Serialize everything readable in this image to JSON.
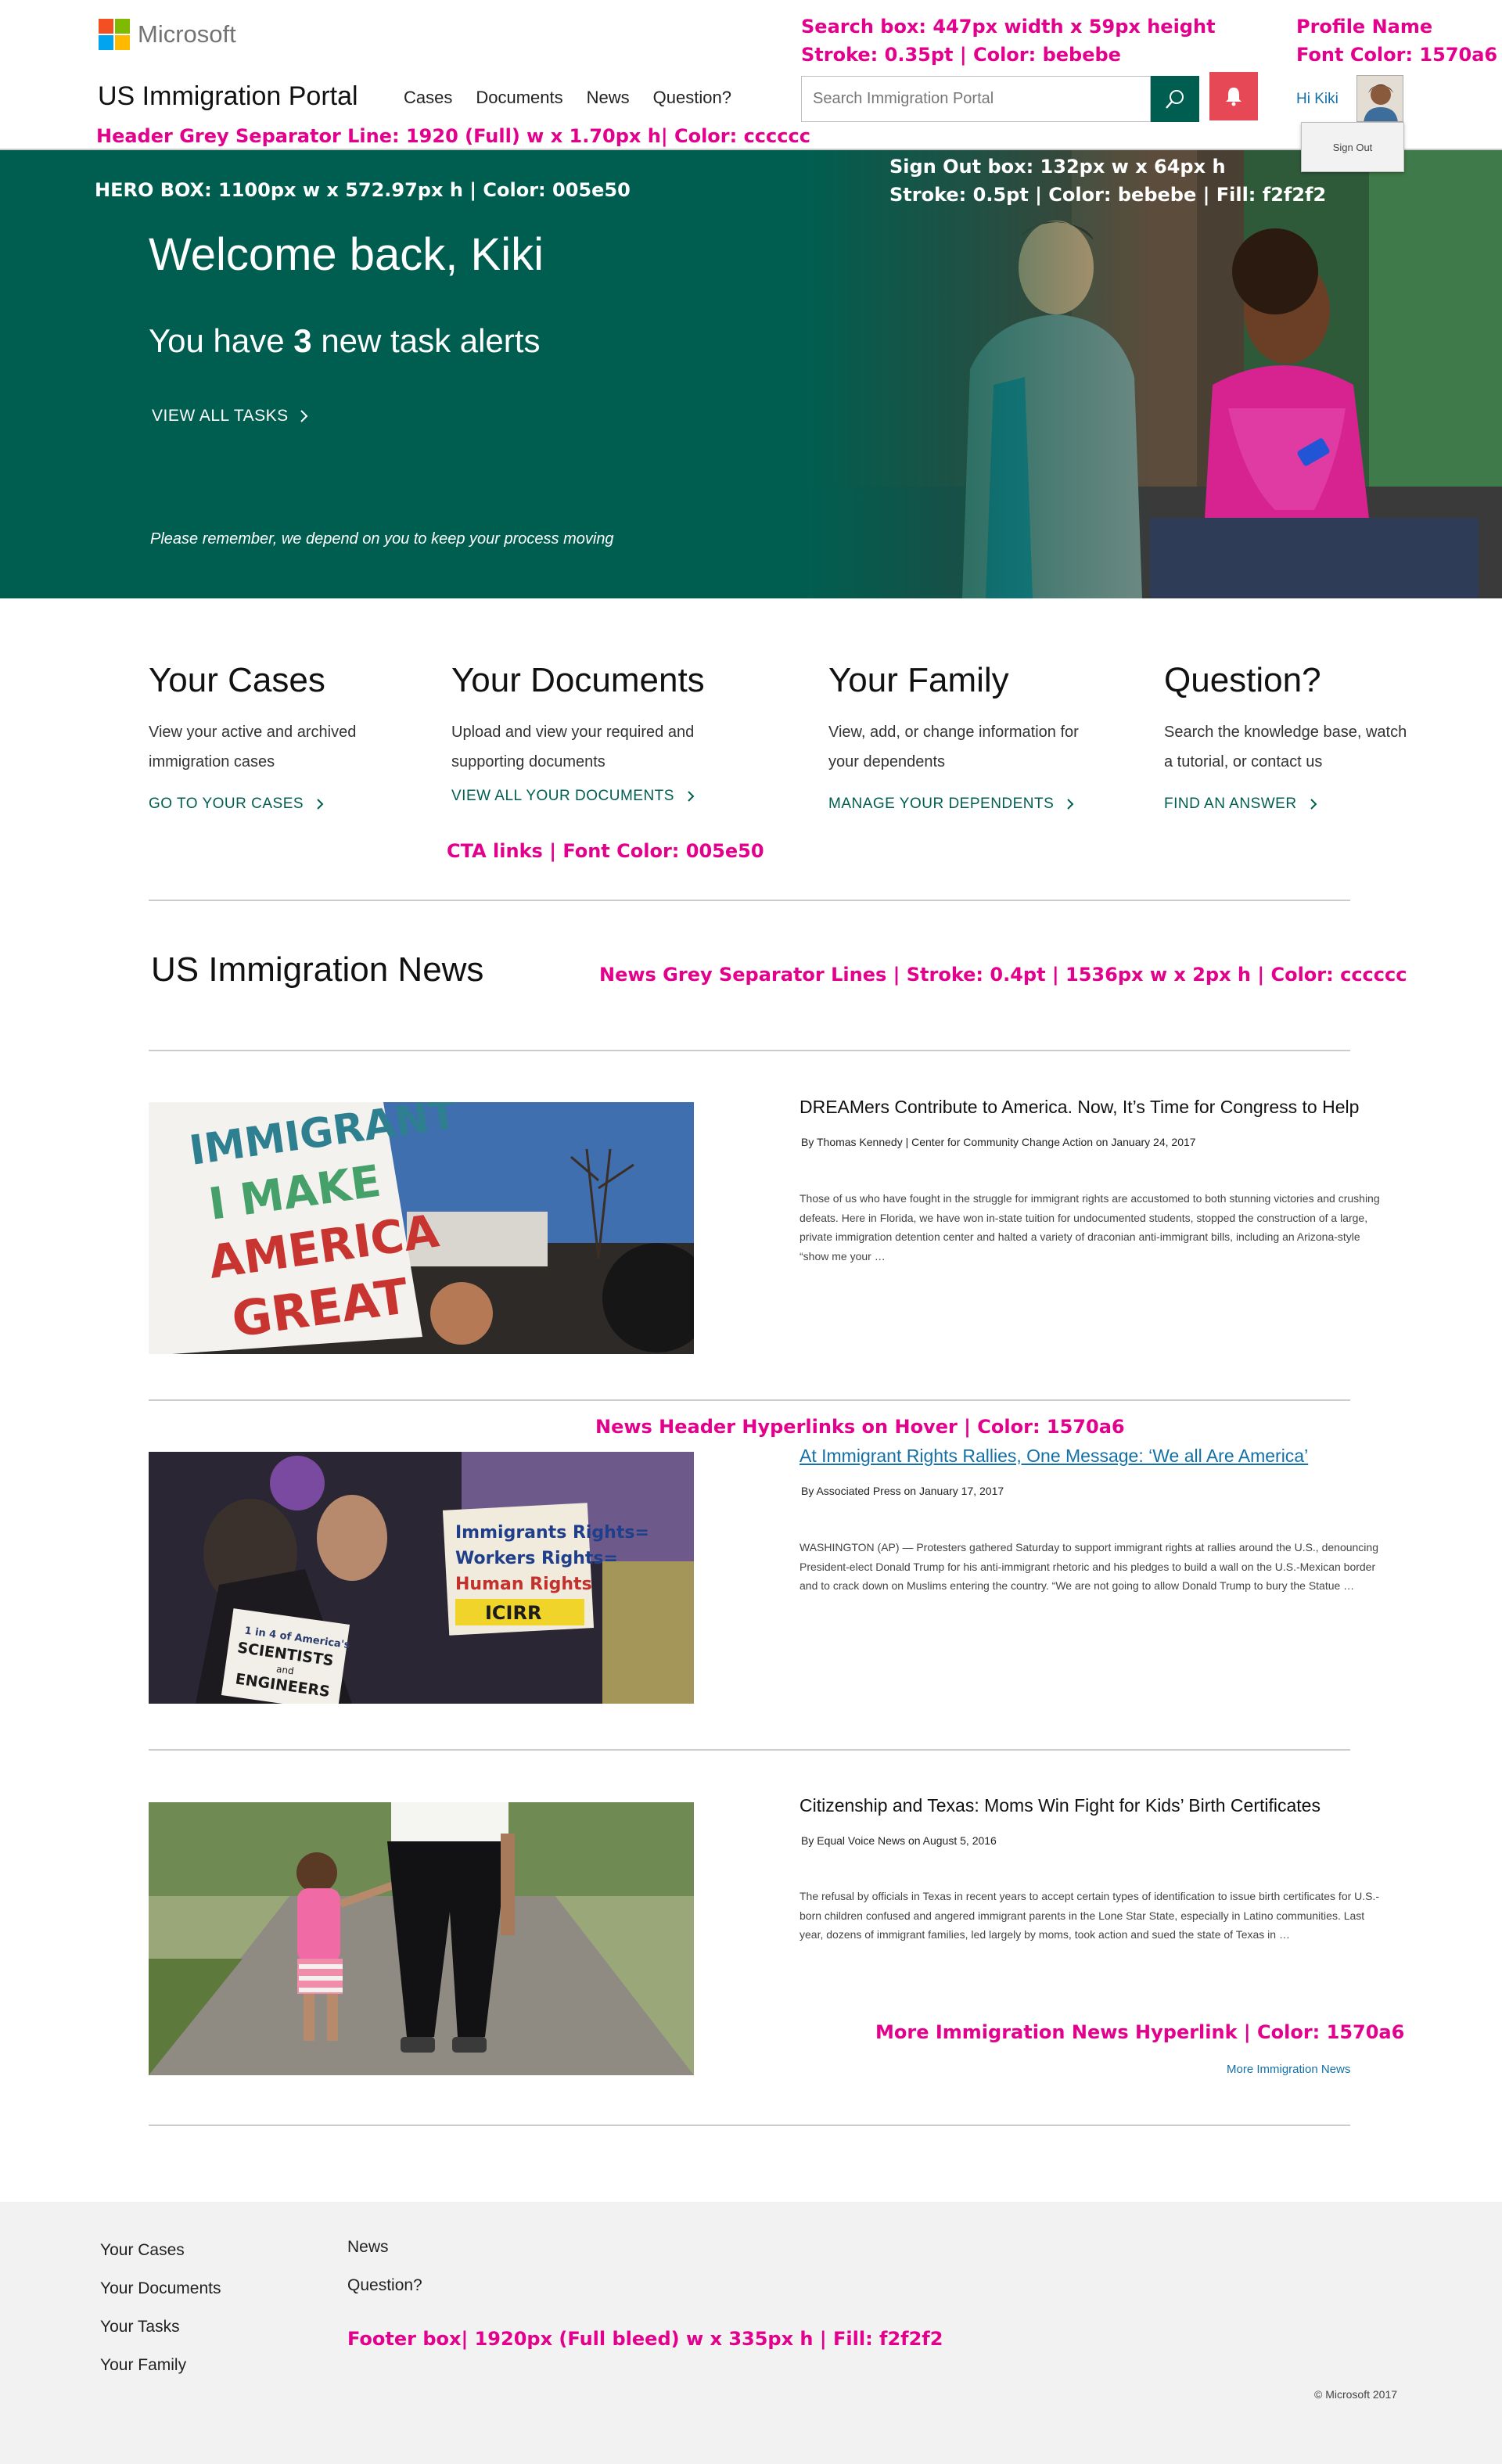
{
  "header": {
    "brand": "Microsoft",
    "portal_title": "US Immigration Portal",
    "nav": [
      "Cases",
      "Documents",
      "News",
      "Question?"
    ],
    "search_placeholder": "Search Immigration Portal",
    "greeting": "Hi Kiki",
    "sign_out": "Sign Out"
  },
  "hero": {
    "welcome": "Welcome back, Kiki",
    "alert_prefix": "You have",
    "alert_count": "3",
    "alert_suffix": "new task alerts",
    "view_all": "VIEW ALL TASKS",
    "remember": "Please remember, we depend on you to keep your process moving"
  },
  "features": [
    {
      "title": "Your Cases",
      "desc": "View your active and archived immigration cases",
      "cta": "GO TO YOUR CASES"
    },
    {
      "title": "Your Documents",
      "desc": "Upload and view your required and supporting documents",
      "cta": "VIEW ALL YOUR DOCUMENTS"
    },
    {
      "title": "Your Family",
      "desc": "View, add, or change information for your dependents",
      "cta": "MANAGE YOUR DEPENDENTS"
    },
    {
      "title": "Question?",
      "desc": "Search the knowledge base, watch a tutorial, or contact us",
      "cta": "FIND AN ANSWER"
    }
  ],
  "news": {
    "section_title": "US Immigration News",
    "items": [
      {
        "headline": "DREAMers Contribute to America. Now, It’s Time for Congress to Help",
        "byline": "By Thomas Kennedy | Center for Community Change Action on January 24, 2017",
        "body": "Those of us who have fought in the struggle for immigrant rights are accustomed to both stunning victories and crushing defeats. Here in Florida, we have won in-state tuition for undocumented students, stopped the construction of a large, private immigration detention center and halted a variety of draconian anti-immigrant bills, including an Arizona-style “show me your …",
        "sign_text": "I IMMIGRANT I MAKE AMERICA GREAT"
      },
      {
        "headline": "At Immigrant Rights Rallies, One Message: ‘We all Are America’",
        "byline": "By Associated Press on January 17, 2017",
        "body": "WASHINGTON (AP) — Protesters gathered Saturday to support immigrant rights at rallies around the U.S., denouncing President-elect Donald Trump for his anti-immigrant rhetoric and his pledges to build a wall on the U.S.-Mexican border and to crack down on Muslims entering the country. “We are not going to allow Donald Trump to bury the Statue …",
        "sign_text": "Immigrants Rights= Workers Rights= Human Rights ICIRR",
        "sign_text_2": "1 in 4 of America's SCIENTISTS and ENGINEERS"
      },
      {
        "headline": "Citizenship and Texas: Moms Win Fight for Kids’ Birth Certificates",
        "byline": "By Equal Voice News on August 5, 2016",
        "body": "The refusal by officials in Texas in recent years to accept certain types of identification to issue birth certificates for U.S.-born children confused and angered immigrant parents in the Lone Star State, especially in Latino communities. Last year, dozens of immigrant families, led largely by moms, took action and sued the state of Texas in …"
      }
    ],
    "more_link": "More Immigration News"
  },
  "footer": {
    "col1": [
      "Your Cases",
      "Your Documents",
      "Your Tasks",
      "Your Family"
    ],
    "col2": [
      "News",
      "Question?"
    ],
    "copyright": "© Microsoft 2017"
  },
  "annotations": {
    "search": [
      "Search box: 447px width x 59px height",
      "Stroke: 0.35pt | Color: bebebe"
    ],
    "profile": [
      "Profile Name",
      "Font Color: 1570a6"
    ],
    "header_sep": "Header Grey Separator Line: 1920 (Full) w x 1.70px h| Color: cccccc",
    "hero_box": "HERO BOX: 1100px w x 572.97px h | Color: 005e50",
    "signout": [
      "Sign Out box: 132px w x 64px h",
      "Stroke: 0.5pt | Color: bebebe | Fill: f2f2f2"
    ],
    "cta_links": "CTA links | Font Color: 005e50",
    "news_sep": "News Grey Separator Lines | Stroke:  0.4pt  | 1536px w x 2px h | Color: cccccc",
    "news_hover": "News Header Hyperlinks on Hover | Color: 1570a6",
    "more_news": "More Immigration News Hyperlink | Color: 1570a6",
    "footer_box": "Footer box| 1920px (Full bleed) w x 335px h | Fill: f2f2f2"
  },
  "colors": {
    "primary": "#005e50",
    "link": "#1570a6",
    "separator": "#cccccc",
    "footer_fill": "#f2f2f2",
    "alert": "#e74856",
    "annotation": "#e3008c"
  }
}
